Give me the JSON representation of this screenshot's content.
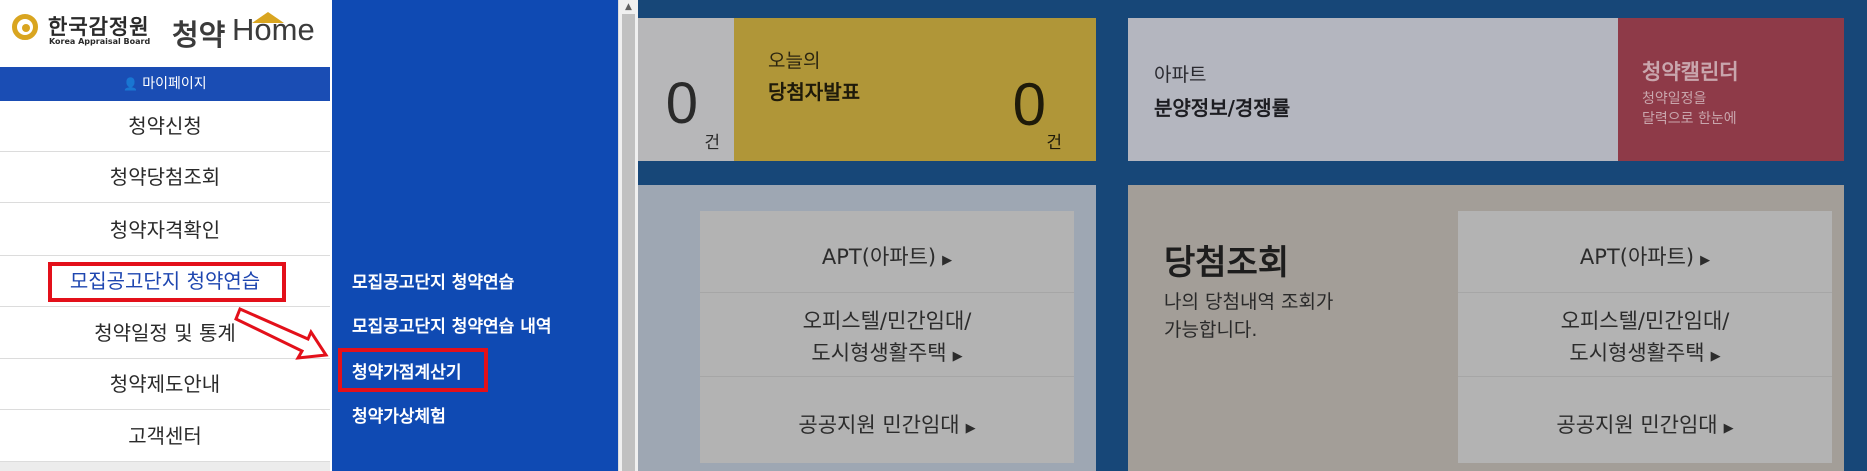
{
  "logo": {
    "org_kr": "한국감정원",
    "org_en": "Korea Appraisal Board",
    "brand_kr": "청약",
    "brand_en": "Home"
  },
  "nav": {
    "mypage_label": "마이페이지",
    "items": [
      {
        "label": "청약신청"
      },
      {
        "label": "청약당첨조회"
      },
      {
        "label": "청약자격확인"
      },
      {
        "label": "모집공고단지 청약연습"
      },
      {
        "label": "청약일정 및 통계"
      },
      {
        "label": "청약제도안내"
      },
      {
        "label": "고객센터"
      }
    ]
  },
  "submenu": {
    "items": [
      {
        "label": "모집공고단지 청약연습"
      },
      {
        "label": "모집공고단지 청약연습 내역"
      },
      {
        "label": "청약가점계산기"
      },
      {
        "label": "청약가상체험"
      }
    ]
  },
  "cards": {
    "count": {
      "value": "0",
      "unit": "건"
    },
    "winner": {
      "line1": "오늘의",
      "line2": "당첨자발표",
      "value": "0",
      "unit": "건"
    },
    "apt": {
      "line1": "아파트",
      "line2": "분양정보/경쟁률"
    },
    "calendar": {
      "title": "청약캘린더",
      "line1": "청약일정을",
      "line2": "달력으로 한눈에"
    }
  },
  "panels": {
    "left_options": {
      "apt": "APT(아파트)",
      "officetel_1": "오피스텔/민간임대/",
      "officetel_2": "도시형생활주택",
      "public": "공공지원 민간임대"
    },
    "right": {
      "title": "당첨조회",
      "desc1": "나의 당첨내역 조회가",
      "desc2": "가능합니다.",
      "apt": "APT(아파트)",
      "officetel_1": "오피스텔/민간임대/",
      "officetel_2": "도시형생활주택",
      "public": "공공지원 민간임대"
    }
  },
  "colors": {
    "nav_blue": "#1a4db4",
    "submenu_blue": "#0f4ab3",
    "highlight_red": "#e3101a",
    "logo_gold": "#d9a520"
  }
}
